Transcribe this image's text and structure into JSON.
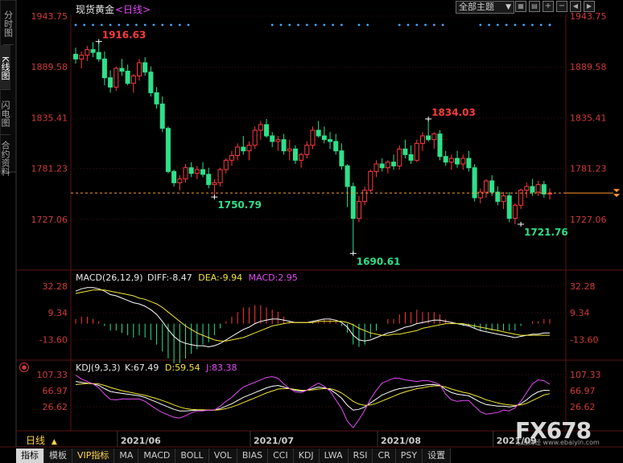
{
  "header": {
    "title": "现货黄金",
    "period_link": "<日线>",
    "theme_select": "全部主题"
  },
  "left_tabs": [
    {
      "label": "分时图"
    },
    {
      "label": "K线图"
    },
    {
      "label": "闪电图"
    },
    {
      "label": "合约资料"
    }
  ],
  "colors": {
    "up": "#ff3b3b",
    "down": "#2ee08a",
    "ma5": "#ffffff",
    "ma10": "#f2e633",
    "ma20": "#e34bf5",
    "current_price_line": "#ff9a2e",
    "axis_text": "#d03a3a",
    "dots": "#4aa8ff",
    "grid": "#3a1010"
  },
  "price_axis": {
    "ticks": [
      "1943.75",
      "1889.58",
      "1835.41",
      "1781.23",
      "1727.06"
    ],
    "min": 1690,
    "max": 1943.75
  },
  "annotations": [
    {
      "label": "1916.63",
      "color": "up"
    },
    {
      "label": "1750.79",
      "color": "down"
    },
    {
      "label": "1834.03",
      "color": "up"
    },
    {
      "label": "1690.61",
      "color": "down"
    },
    {
      "label": "1721.76",
      "color": "down"
    }
  ],
  "macd_panel": {
    "title": "MACD(26,12,9)",
    "diff": "DIFF:-8.47",
    "dea": "DEA:-9.94",
    "macd": "MACD:2.95",
    "ticks": [
      "32.28",
      "9.34",
      "-13.60"
    ]
  },
  "kdj_panel": {
    "title": "KDJ(9,3,3)",
    "k": "K:67.49",
    "d": "D:59.54",
    "j": "J:83.38",
    "ticks": [
      "107.33",
      "66.97",
      "26.62"
    ]
  },
  "date_axis": {
    "labels": [
      "2021/06",
      "2021/07",
      "2021/08",
      "2021/09"
    ],
    "period_button": "日线"
  },
  "bottom_tabs": [
    "指标",
    "模板",
    "VIP指标",
    "MA",
    "MACD",
    "BOLL",
    "VOL",
    "BIAS",
    "CCI",
    "KDJ",
    "LWA",
    "RSI",
    "CR",
    "PSY",
    "设置"
  ],
  "watermark": {
    "brand": "FX678",
    "site": "汇通财经 www.ebaiyin.com"
  },
  "chart_data": {
    "type": "candlestick",
    "title": "现货黄金 日线",
    "ylim": [
      1690,
      1943.75
    ],
    "ohlc": [
      [
        1903,
        1910,
        1893,
        1898
      ],
      [
        1898,
        1906,
        1888,
        1902
      ],
      [
        1902,
        1912,
        1896,
        1908
      ],
      [
        1908,
        1916,
        1900,
        1905
      ],
      [
        1905,
        1916.63,
        1895,
        1898
      ],
      [
        1898,
        1906,
        1870,
        1878
      ],
      [
        1878,
        1886,
        1862,
        1868
      ],
      [
        1868,
        1890,
        1864,
        1888
      ],
      [
        1888,
        1898,
        1880,
        1885
      ],
      [
        1885,
        1892,
        1870,
        1872
      ],
      [
        1872,
        1882,
        1862,
        1880
      ],
      [
        1880,
        1898,
        1875,
        1894
      ],
      [
        1894,
        1900,
        1880,
        1884
      ],
      [
        1884,
        1890,
        1858,
        1862
      ],
      [
        1862,
        1868,
        1845,
        1850
      ],
      [
        1850,
        1858,
        1820,
        1824
      ],
      [
        1824,
        1826,
        1776,
        1778
      ],
      [
        1778,
        1780,
        1762,
        1766
      ],
      [
        1766,
        1774,
        1758,
        1770
      ],
      [
        1770,
        1786,
        1766,
        1782
      ],
      [
        1782,
        1788,
        1772,
        1776
      ],
      [
        1776,
        1784,
        1770,
        1780
      ],
      [
        1780,
        1788,
        1772,
        1775
      ],
      [
        1775,
        1782,
        1760,
        1764
      ],
      [
        1764,
        1770,
        1750.79,
        1766
      ],
      [
        1766,
        1782,
        1762,
        1780
      ],
      [
        1780,
        1792,
        1776,
        1790
      ],
      [
        1790,
        1800,
        1784,
        1795
      ],
      [
        1795,
        1808,
        1790,
        1804
      ],
      [
        1804,
        1816,
        1796,
        1800
      ],
      [
        1800,
        1810,
        1790,
        1806
      ],
      [
        1806,
        1826,
        1802,
        1822
      ],
      [
        1822,
        1832,
        1812,
        1828
      ],
      [
        1828,
        1834,
        1814,
        1816
      ],
      [
        1816,
        1820,
        1804,
        1810
      ],
      [
        1810,
        1816,
        1800,
        1812
      ],
      [
        1812,
        1818,
        1796,
        1800
      ],
      [
        1800,
        1812,
        1790,
        1802
      ],
      [
        1802,
        1806,
        1786,
        1790
      ],
      [
        1790,
        1798,
        1782,
        1796
      ],
      [
        1796,
        1810,
        1792,
        1806
      ],
      [
        1806,
        1826,
        1802,
        1822
      ],
      [
        1822,
        1832,
        1814,
        1816
      ],
      [
        1816,
        1826,
        1808,
        1812
      ],
      [
        1812,
        1820,
        1802,
        1810
      ],
      [
        1810,
        1818,
        1796,
        1800
      ],
      [
        1800,
        1808,
        1780,
        1784
      ],
      [
        1784,
        1786,
        1740,
        1762
      ],
      [
        1762,
        1766,
        1690.61,
        1728
      ],
      [
        1728,
        1752,
        1724,
        1746
      ],
      [
        1746,
        1762,
        1742,
        1758
      ],
      [
        1758,
        1780,
        1756,
        1778
      ],
      [
        1778,
        1790,
        1772,
        1786
      ],
      [
        1786,
        1792,
        1778,
        1782
      ],
      [
        1782,
        1790,
        1776,
        1788
      ],
      [
        1788,
        1796,
        1780,
        1784
      ],
      [
        1784,
        1806,
        1780,
        1802
      ],
      [
        1802,
        1812,
        1792,
        1796
      ],
      [
        1796,
        1806,
        1786,
        1790
      ],
      [
        1790,
        1812,
        1788,
        1808
      ],
      [
        1808,
        1820,
        1800,
        1816
      ],
      [
        1816,
        1834.03,
        1810,
        1812
      ],
      [
        1812,
        1820,
        1802,
        1818
      ],
      [
        1818,
        1822,
        1790,
        1794
      ],
      [
        1794,
        1800,
        1784,
        1788
      ],
      [
        1788,
        1796,
        1780,
        1792
      ],
      [
        1792,
        1800,
        1782,
        1786
      ],
      [
        1786,
        1796,
        1780,
        1792
      ],
      [
        1792,
        1800,
        1778,
        1782
      ],
      [
        1782,
        1786,
        1746,
        1750
      ],
      [
        1750,
        1760,
        1744,
        1756
      ],
      [
        1756,
        1770,
        1750,
        1768
      ],
      [
        1768,
        1774,
        1752,
        1756
      ],
      [
        1756,
        1762,
        1742,
        1746
      ],
      [
        1746,
        1756,
        1738,
        1752
      ],
      [
        1752,
        1756,
        1724,
        1728
      ],
      [
        1728,
        1744,
        1721.76,
        1742
      ],
      [
        1742,
        1760,
        1738,
        1758
      ],
      [
        1758,
        1766,
        1750,
        1762
      ],
      [
        1762,
        1770,
        1752,
        1756
      ],
      [
        1756,
        1768,
        1752,
        1764
      ],
      [
        1764,
        1768,
        1750,
        1754
      ],
      [
        1754,
        1760,
        1748,
        1755
      ]
    ],
    "last_price": 1755,
    "series": [
      {
        "name": "DIFF",
        "values": [
          28,
          30,
          31,
          31,
          30,
          28,
          25,
          24,
          22,
          20,
          18,
          17,
          15,
          12,
          8,
          2,
          -5,
          -11,
          -15,
          -17,
          -18,
          -19,
          -19,
          -20,
          -19,
          -17,
          -14,
          -11,
          -8,
          -5,
          -3,
          0,
          2,
          3,
          4,
          4,
          3,
          2,
          1,
          1,
          1,
          2,
          3,
          4,
          4,
          3,
          1,
          -3,
          -10,
          -14,
          -15,
          -14,
          -12,
          -10,
          -8,
          -7,
          -5,
          -3,
          -2,
          0,
          1,
          2,
          3,
          3,
          2,
          1,
          0,
          -1,
          -2,
          -4,
          -6,
          -7,
          -8,
          -9,
          -10,
          -11,
          -12,
          -11,
          -10,
          -9,
          -9,
          -8,
          -8
        ]
      },
      {
        "name": "DEA",
        "values": [
          26,
          27,
          28,
          29,
          29,
          29,
          28,
          27,
          26,
          25,
          24,
          22,
          21,
          19,
          17,
          14,
          10,
          6,
          2,
          -2,
          -5,
          -8,
          -10,
          -12,
          -14,
          -15,
          -15,
          -14,
          -13,
          -12,
          -10,
          -8,
          -6,
          -4,
          -2,
          -1,
          0,
          1,
          1,
          1,
          1,
          1,
          2,
          2,
          2,
          2,
          2,
          1,
          -1,
          -4,
          -6,
          -8,
          -9,
          -10,
          -10,
          -9,
          -9,
          -8,
          -7,
          -6,
          -4,
          -3,
          -2,
          -1,
          0,
          0,
          0,
          0,
          -1,
          -2,
          -3,
          -4,
          -5,
          -6,
          -7,
          -8,
          -9,
          -10,
          -10,
          -10,
          -10,
          -10,
          -10
        ]
      },
      {
        "name": "K",
        "values": [
          90,
          88,
          86,
          84,
          80,
          72,
          65,
          62,
          60,
          58,
          56,
          54,
          50,
          44,
          38,
          32,
          26,
          20,
          16,
          16,
          17,
          18,
          18,
          18,
          18,
          22,
          28,
          34,
          42,
          50,
          56,
          62,
          68,
          74,
          78,
          80,
          76,
          72,
          68,
          66,
          68,
          72,
          76,
          74,
          70,
          60,
          48,
          30,
          18,
          20,
          26,
          36,
          46,
          56,
          62,
          68,
          72,
          74,
          76,
          78,
          80,
          82,
          82,
          80,
          70,
          62,
          58,
          56,
          54,
          46,
          38,
          32,
          30,
          28,
          28,
          26,
          28,
          34,
          44,
          56,
          64,
          68,
          67.49
        ]
      },
      {
        "name": "D",
        "values": [
          82,
          84,
          85,
          85,
          84,
          80,
          75,
          71,
          67,
          64,
          61,
          58,
          55,
          51,
          47,
          42,
          37,
          31,
          26,
          22,
          20,
          19,
          19,
          18,
          18,
          19,
          22,
          26,
          31,
          37,
          43,
          49,
          55,
          61,
          66,
          71,
          72,
          72,
          70,
          68,
          68,
          69,
          71,
          72,
          72,
          68,
          61,
          51,
          40,
          33,
          30,
          31,
          35,
          41,
          47,
          53,
          59,
          64,
          68,
          72,
          74,
          77,
          79,
          79,
          76,
          71,
          67,
          63,
          60,
          55,
          50,
          44,
          40,
          36,
          33,
          31,
          30,
          31,
          35,
          42,
          49,
          56,
          59.54
        ]
      },
      {
        "name": "J",
        "values": [
          106,
          96,
          90,
          84,
          74,
          58,
          45,
          44,
          46,
          46,
          46,
          46,
          40,
          30,
          20,
          12,
          6,
          0,
          -2,
          4,
          11,
          16,
          16,
          18,
          18,
          28,
          40,
          50,
          64,
          76,
          82,
          88,
          94,
          100,
          102,
          98,
          84,
          72,
          64,
          62,
          68,
          78,
          86,
          78,
          66,
          44,
          22,
          -10,
          -26,
          -6,
          18,
          46,
          68,
          86,
          92,
          98,
          98,
          94,
          92,
          90,
          92,
          92,
          88,
          82,
          58,
          44,
          40,
          42,
          42,
          28,
          14,
          8,
          10,
          12,
          18,
          16,
          24,
          40,
          62,
          84,
          94,
          92,
          83.38
        ]
      }
    ]
  }
}
